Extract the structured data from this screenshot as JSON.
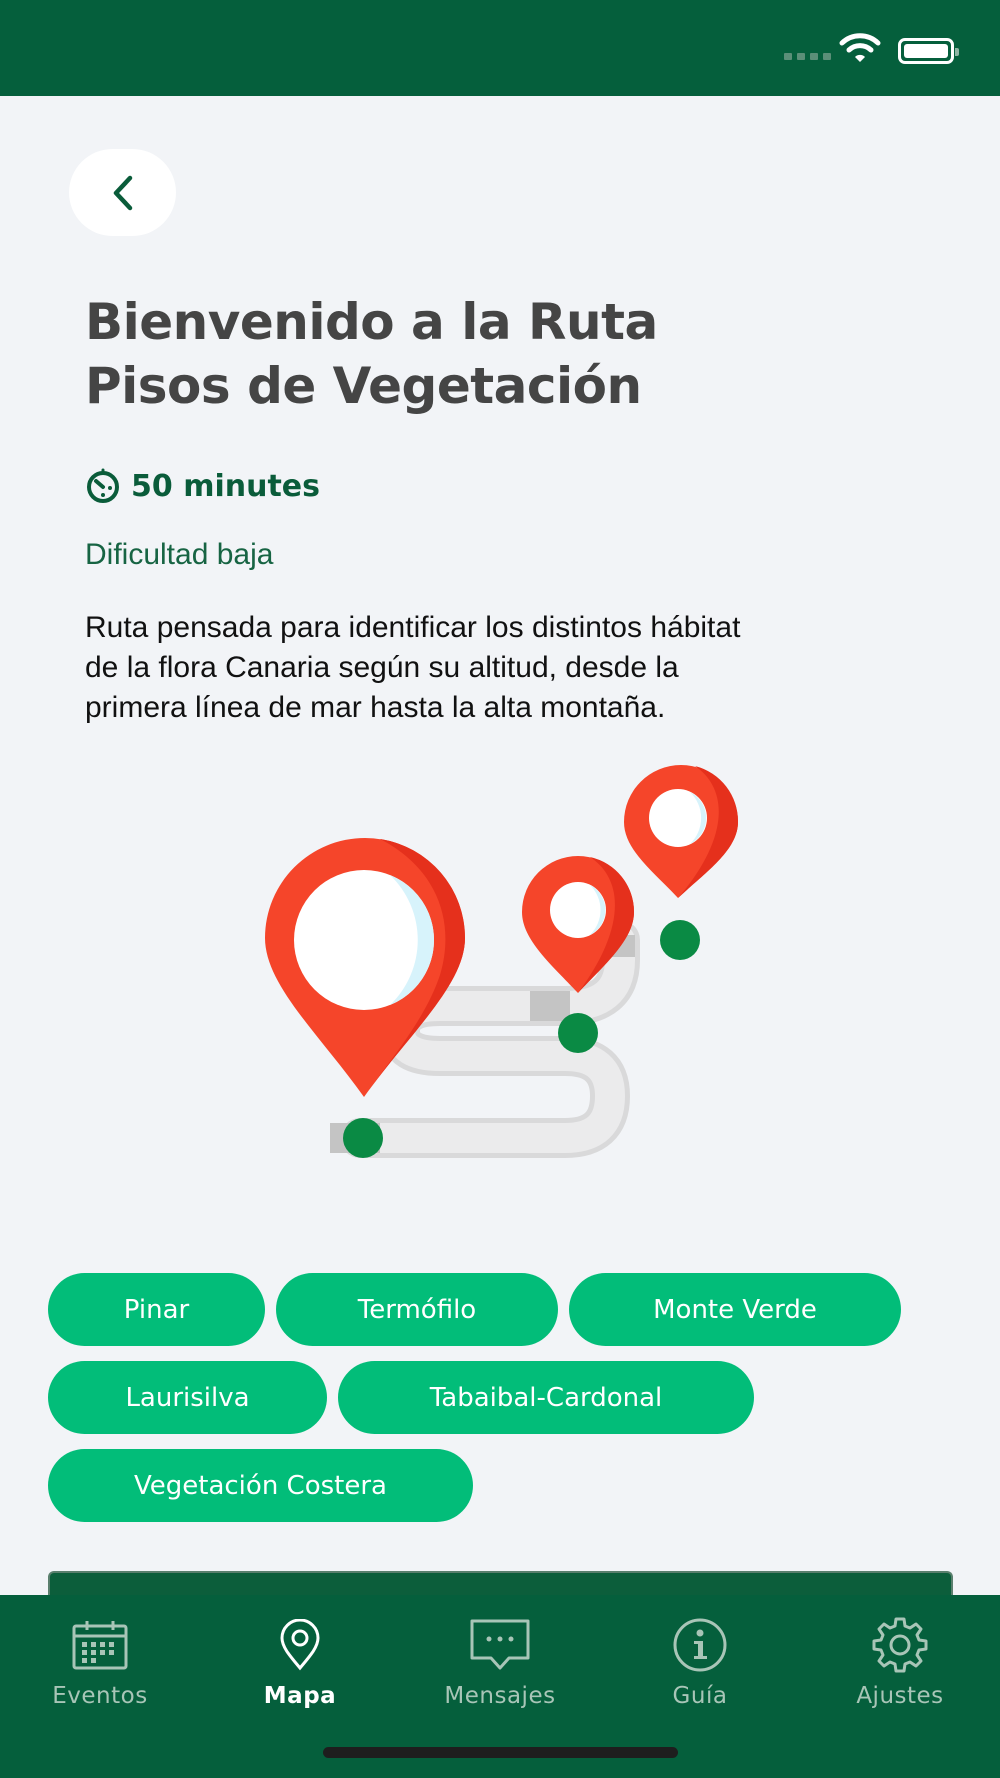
{
  "status_bar": {
    "wifi_icon": "wifi-icon",
    "battery_icon": "battery-icon"
  },
  "header": {
    "back_icon": "chevron-left-icon"
  },
  "route": {
    "title_line1": "Bienvenido a la Ruta",
    "title_line2": "Pisos de Vegetación",
    "duration_icon": "timer-icon",
    "duration": "50 minutes",
    "difficulty": "Dificultad baja",
    "description_lines": [
      "Ruta pensada para identificar los distintos hábitat",
      "de la flora Canaria según su altitud, desde la",
      "primera línea de mar hasta la alta montaña."
    ]
  },
  "illustration": {
    "icon": "route-map-pins-illustration",
    "pin_color": "#f5452a",
    "node_color": "#0a8a44"
  },
  "chips": [
    {
      "label": "Pinar"
    },
    {
      "label": "Termófilo"
    },
    {
      "label": "Monte Verde"
    },
    {
      "label": "Laurisilva"
    },
    {
      "label": "Tabaibal-Cardonal"
    },
    {
      "label": "Vegetación Costera"
    }
  ],
  "tabbar": {
    "active": "Mapa",
    "items": [
      {
        "label": "Eventos",
        "icon": "calendar-icon"
      },
      {
        "label": "Mapa",
        "icon": "map-pin-icon"
      },
      {
        "label": "Mensajes",
        "icon": "message-icon"
      },
      {
        "label": "Guía",
        "icon": "info-icon"
      },
      {
        "label": "Ajustes",
        "icon": "gear-icon"
      }
    ]
  },
  "colors": {
    "primary_dark": "#055f3c",
    "chip": "#02bd79",
    "background": "#f2f4f7"
  }
}
